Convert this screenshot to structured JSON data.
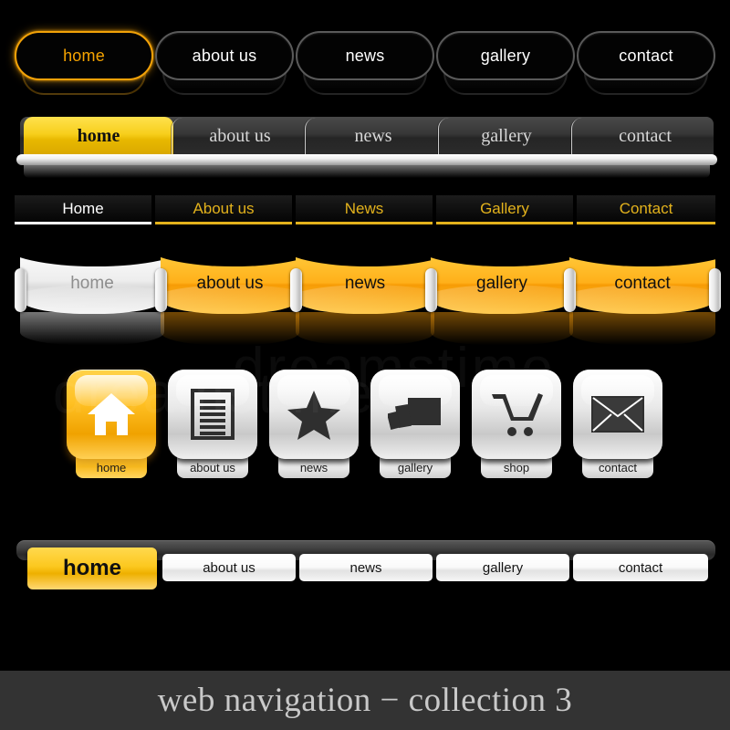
{
  "background_color": "#000000",
  "accent_gold": "#f2a208",
  "accent_yellow": "#fcc81f",
  "nav1": {
    "style_name": "outlined-pill-nav",
    "items": [
      {
        "label": "home",
        "active": true
      },
      {
        "label": "about us",
        "active": false
      },
      {
        "label": "news",
        "active": false
      },
      {
        "label": "gallery",
        "active": false
      },
      {
        "label": "contact",
        "active": false
      }
    ]
  },
  "nav2": {
    "style_name": "serif-tab-bar",
    "items": [
      {
        "label": "home",
        "active": true
      },
      {
        "label": "about us",
        "active": false
      },
      {
        "label": "news",
        "active": false
      },
      {
        "label": "gallery",
        "active": false
      },
      {
        "label": "contact",
        "active": false
      }
    ]
  },
  "nav3": {
    "style_name": "underline-link-nav",
    "items": [
      {
        "label": "Home",
        "active": true
      },
      {
        "label": "About us",
        "active": false
      },
      {
        "label": "News",
        "active": false
      },
      {
        "label": "Gallery",
        "active": false
      },
      {
        "label": "Contact",
        "active": false
      }
    ]
  },
  "nav4": {
    "style_name": "ribbon-nav",
    "items": [
      {
        "label": "home",
        "active": true
      },
      {
        "label": "about us",
        "active": false
      },
      {
        "label": "news",
        "active": false
      },
      {
        "label": "gallery",
        "active": false
      },
      {
        "label": "contact",
        "active": false
      }
    ]
  },
  "nav5": {
    "style_name": "icon-button-nav",
    "items": [
      {
        "label": "home",
        "icon": "house-icon",
        "active": true
      },
      {
        "label": "about us",
        "icon": "document-lines-icon",
        "active": false
      },
      {
        "label": "news",
        "icon": "star-icon",
        "active": false
      },
      {
        "label": "gallery",
        "icon": "photos-icon",
        "active": false
      },
      {
        "label": "shop",
        "icon": "shopping-cart-icon",
        "active": false
      },
      {
        "label": "contact",
        "icon": "envelope-icon",
        "active": false
      }
    ]
  },
  "nav6": {
    "style_name": "white-tab-bar",
    "items": [
      {
        "label": "home",
        "active": true
      },
      {
        "label": "about us",
        "active": false
      },
      {
        "label": "news",
        "active": false
      },
      {
        "label": "gallery",
        "active": false
      },
      {
        "label": "contact",
        "active": false
      }
    ]
  },
  "footer": {
    "title": "web navigation − collection 3"
  },
  "watermark": {
    "line1": "dreamstime",
    "line2": "dreamstime"
  }
}
